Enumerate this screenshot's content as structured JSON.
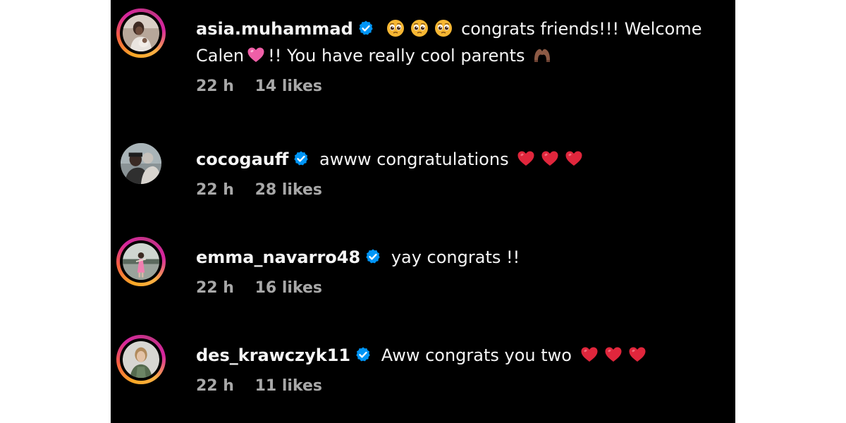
{
  "colors": {
    "background": "#000000",
    "text": "#f5f5f5",
    "meta": "#a8a8a8",
    "verified": "#0095f6",
    "heart_red": "#e0263c"
  },
  "comments": [
    {
      "username": "asia.muhammad",
      "verified_icon": "verified-badge-icon",
      "text_a": "congrats friends!!! Welcome",
      "text_b": "Calen",
      "text_c": "!! You have really cool parents",
      "emojis": [
        "pleading-face-icon",
        "pleading-face-icon",
        "pleading-face-icon",
        "pink-heart-icon",
        "heart-hands-icon"
      ],
      "time": "22 h",
      "likes": "14 likes"
    },
    {
      "username": "cocogauff",
      "verified_icon": "verified-badge-icon",
      "text": "awww congratulations",
      "emojis": [
        "red-heart-icon",
        "red-heart-icon",
        "red-heart-icon"
      ],
      "time": "22 h",
      "likes": "28 likes"
    },
    {
      "username": "emma_navarro48",
      "verified_icon": "verified-badge-icon",
      "text": "yay congrats !!",
      "time": "22 h",
      "likes": "16 likes"
    },
    {
      "username": "des_krawczyk11",
      "verified_icon": "verified-badge-icon",
      "text": "Aww congrats you two",
      "emojis": [
        "red-heart-icon",
        "red-heart-icon",
        "red-heart-icon"
      ],
      "time": "22 h",
      "likes": "11 likes"
    }
  ]
}
